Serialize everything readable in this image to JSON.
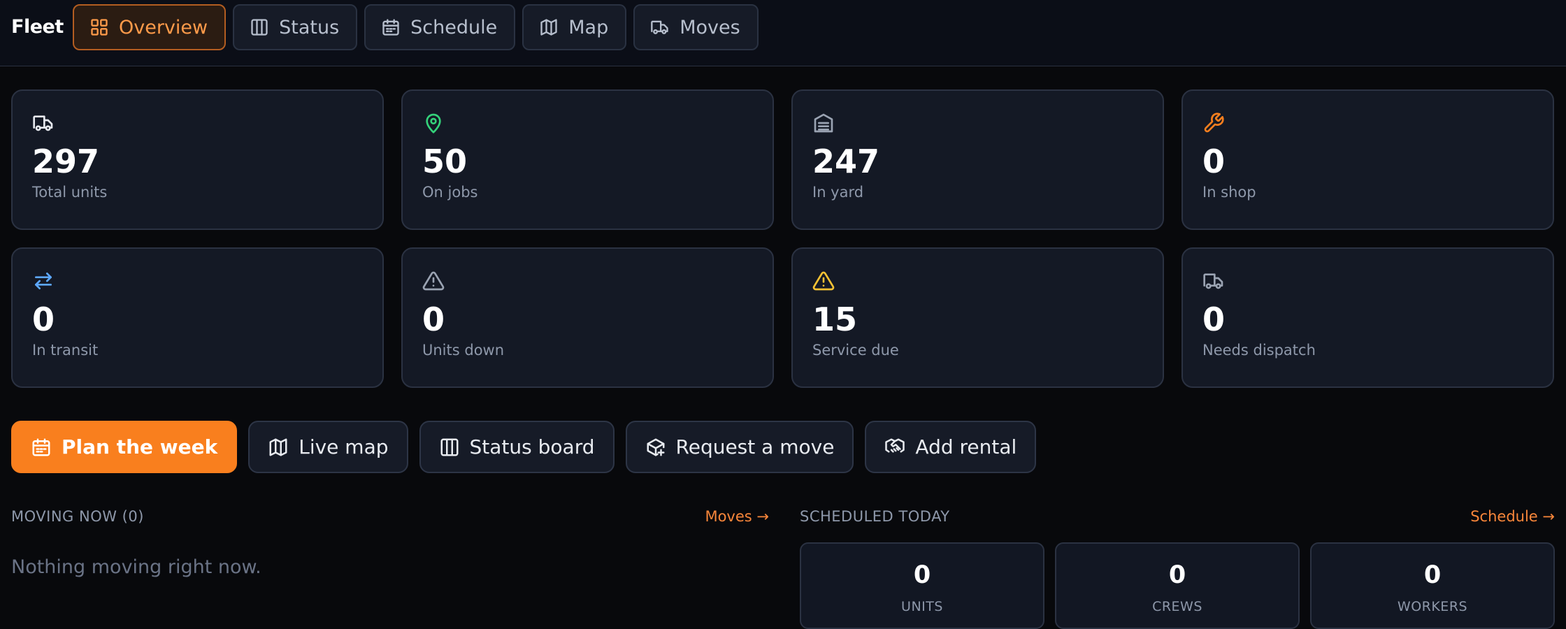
{
  "nav": {
    "brand": "Fleet",
    "tabs": [
      {
        "label": "Overview",
        "icon": "grid-icon",
        "active": true
      },
      {
        "label": "Status",
        "icon": "columns-icon",
        "active": false
      },
      {
        "label": "Schedule",
        "icon": "calendar-icon",
        "active": false
      },
      {
        "label": "Map",
        "icon": "map-icon",
        "active": false
      },
      {
        "label": "Moves",
        "icon": "truck-icon",
        "active": false
      }
    ]
  },
  "stats": [
    {
      "value": "297",
      "label": "Total units",
      "icon": "truck-icon",
      "color": "#e6e8ee"
    },
    {
      "value": "50",
      "label": "On jobs",
      "icon": "map-pin-icon",
      "color": "#34d27a"
    },
    {
      "value": "247",
      "label": "In yard",
      "icon": "warehouse-icon",
      "color": "#9aa3b2"
    },
    {
      "value": "0",
      "label": "In shop",
      "icon": "wrench-icon",
      "color": "#f97f1e"
    },
    {
      "value": "0",
      "label": "In transit",
      "icon": "arrows-exchange-icon",
      "color": "#5da8ff"
    },
    {
      "value": "0",
      "label": "Units down",
      "icon": "alert-triangle-icon",
      "color": "#9aa3b2"
    },
    {
      "value": "15",
      "label": "Service due",
      "icon": "alert-triangle-icon",
      "color": "#f5c234"
    },
    {
      "value": "0",
      "label": "Needs dispatch",
      "icon": "truck-icon",
      "color": "#9aa3b2"
    }
  ],
  "actions": [
    {
      "label": "Plan the week",
      "icon": "calendar-icon",
      "primary": true
    },
    {
      "label": "Live map",
      "icon": "map-icon",
      "primary": false
    },
    {
      "label": "Status board",
      "icon": "columns-icon",
      "primary": false
    },
    {
      "label": "Request a move",
      "icon": "package-plus-icon",
      "primary": false
    },
    {
      "label": "Add rental",
      "icon": "handshake-icon",
      "primary": false
    }
  ],
  "moving_now": {
    "title": "MOVING NOW (0)",
    "link": "Moves →",
    "empty": "Nothing moving right now."
  },
  "scheduled_today": {
    "title": "SCHEDULED TODAY",
    "link": "Schedule →",
    "items": [
      {
        "value": "0",
        "label": "UNITS"
      },
      {
        "value": "0",
        "label": "CREWS"
      },
      {
        "value": "0",
        "label": "WORKERS"
      }
    ]
  },
  "colors": {
    "accent": "#f97f1e",
    "background": "#08090c",
    "card": "#141925"
  }
}
